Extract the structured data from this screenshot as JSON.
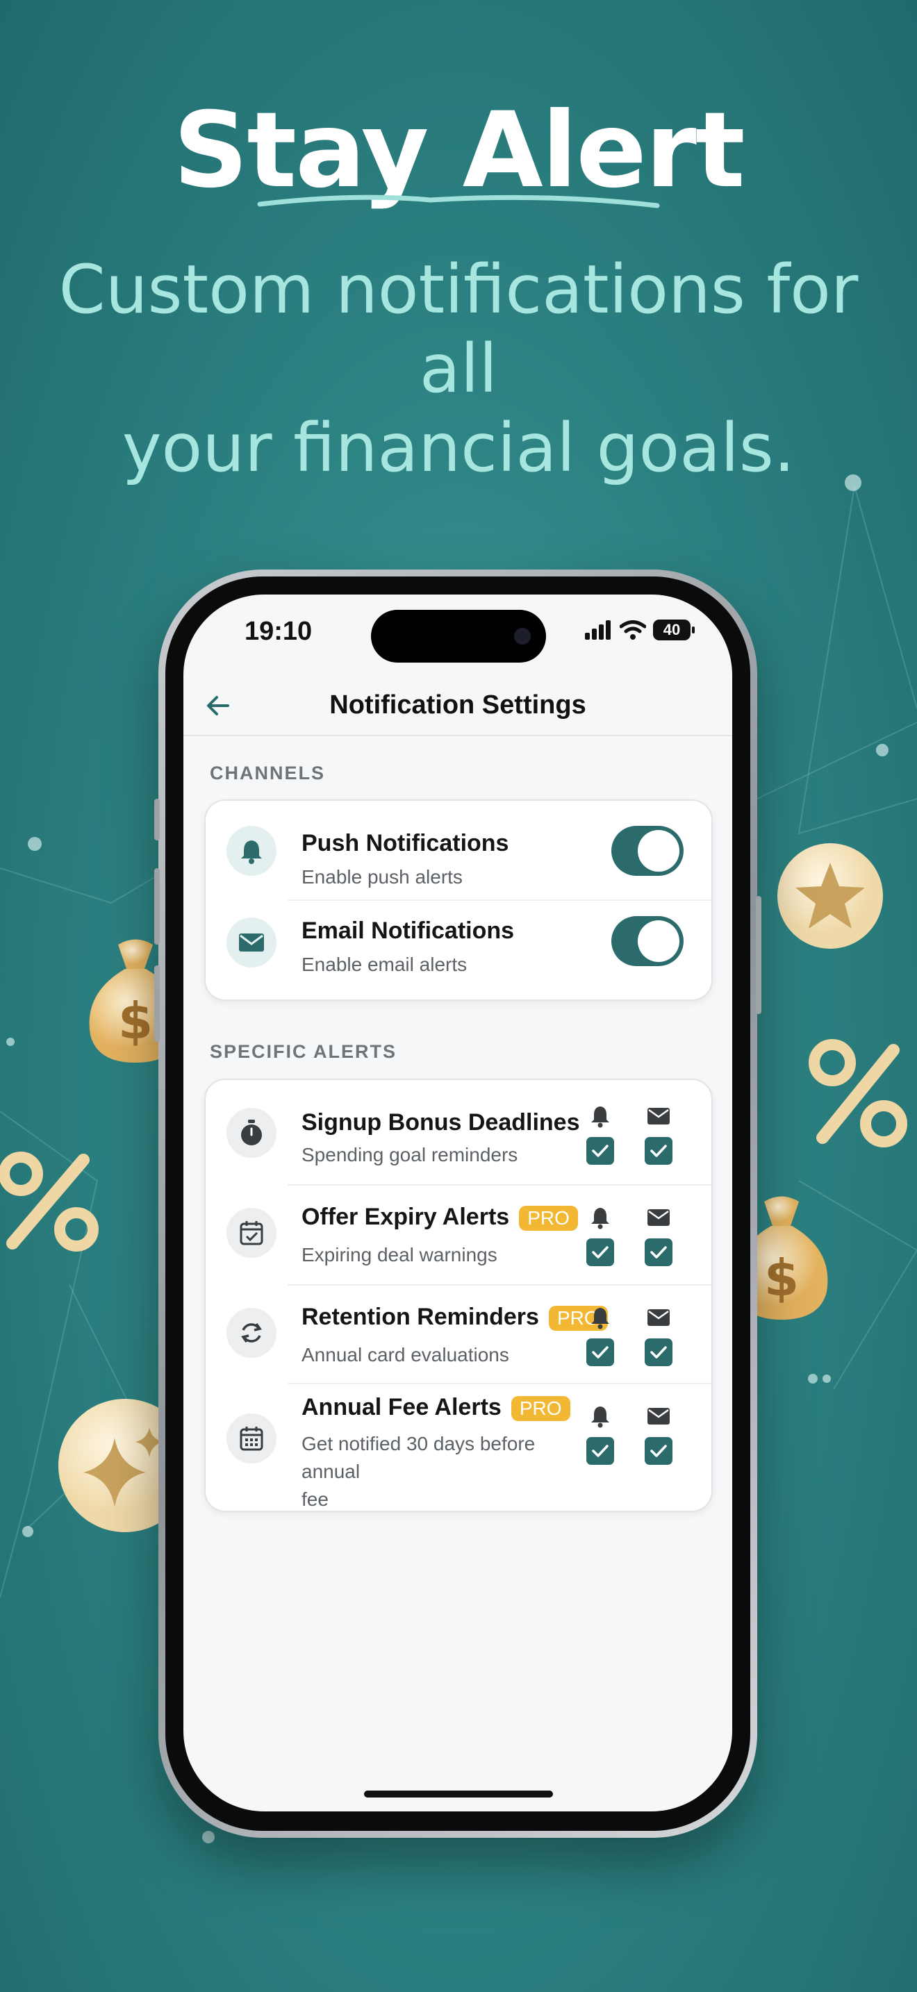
{
  "hero": {
    "title": "Stay Alert",
    "subtitle_line1": "Custom notifications for all",
    "subtitle_line2": "your financial goals."
  },
  "status_bar": {
    "time": "19:10",
    "battery": "40"
  },
  "nav": {
    "title": "Notification Settings"
  },
  "channels": {
    "label": "CHANNELS",
    "items": [
      {
        "title": "Push Notifications",
        "subtitle": "Enable push alerts",
        "icon": "bell-icon",
        "enabled": true
      },
      {
        "title": "Email Notifications",
        "subtitle": "Enable email alerts",
        "icon": "mail-icon",
        "enabled": true
      }
    ]
  },
  "specific_alerts": {
    "label": "SPECIFIC ALERTS",
    "items": [
      {
        "title": "Signup Bonus Deadlines",
        "subtitle": "Spending goal reminders",
        "icon": "stopwatch-icon",
        "push": true,
        "email": true
      },
      {
        "title": "Offer Expiry Alerts",
        "badge": "PRO",
        "subtitle": "Expiring deal warnings",
        "icon": "calendar-check-icon",
        "push": true,
        "email": true
      },
      {
        "title": "Retention Reminders",
        "badge": "PRO",
        "subtitle": "Annual card evaluations",
        "icon": "refresh-icon",
        "push": true,
        "email": true
      },
      {
        "title": "Annual Fee Alerts",
        "badge": "PRO",
        "subtitle_line1": "Get notified 30 days before annual",
        "subtitle_line2": "fee",
        "icon": "calendar-icon",
        "push": true,
        "email": true
      }
    ]
  },
  "colors": {
    "accent": "#2b6b6b",
    "pro_badge": "#f3b833",
    "background": "#2f8585",
    "coin": "#f3e3c4"
  }
}
